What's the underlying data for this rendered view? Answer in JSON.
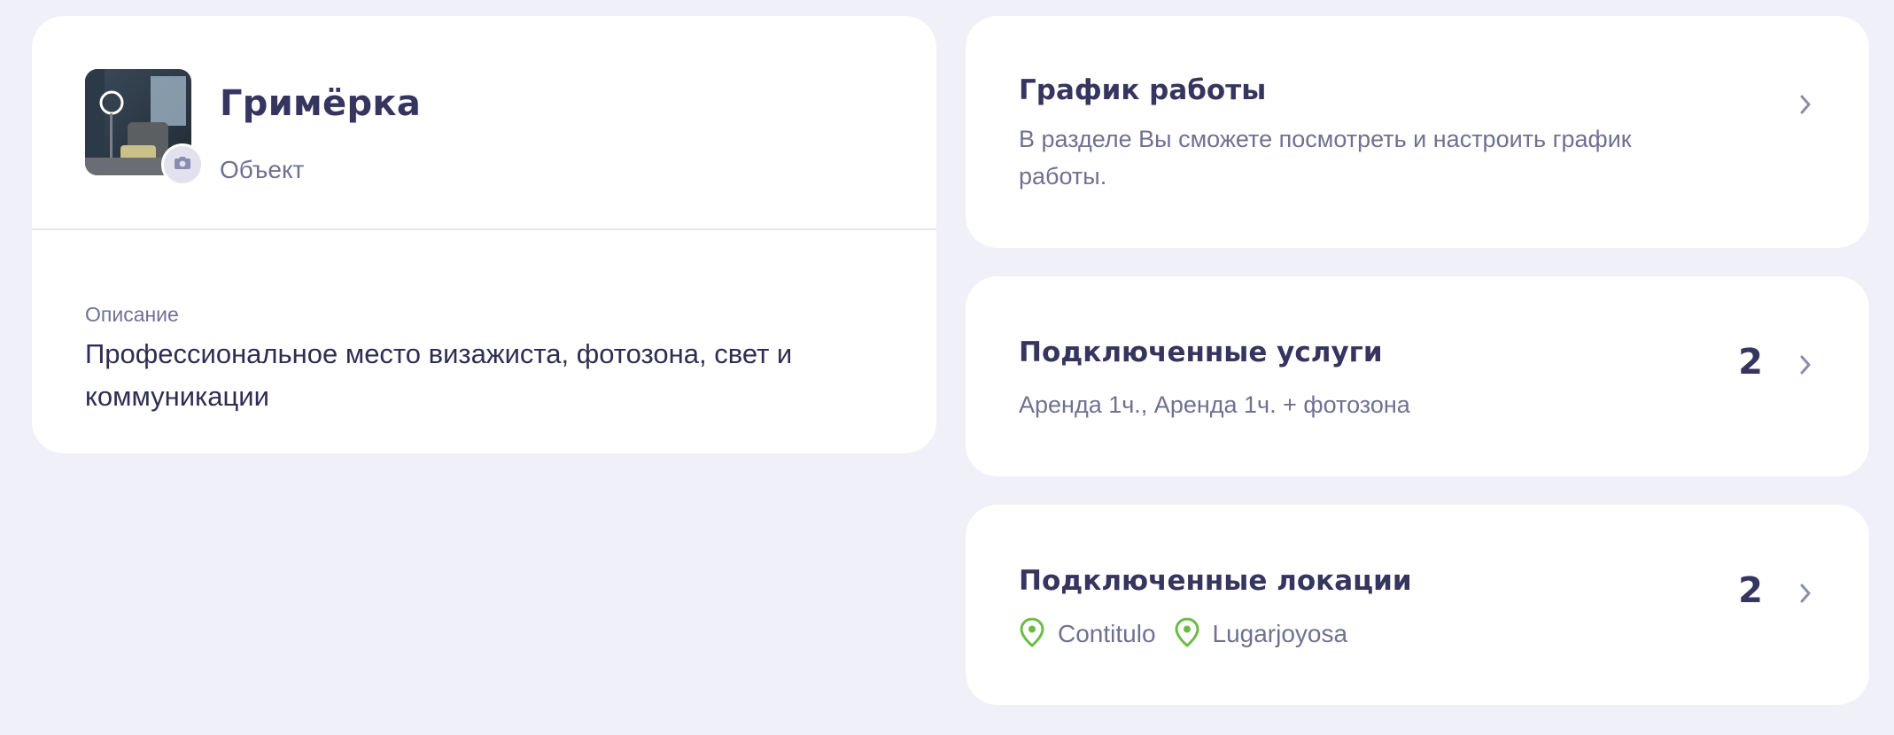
{
  "object": {
    "title": "Гримёрка",
    "type": "Объект",
    "description_label": "Описание",
    "description": "Профессиональное место визажиста, фотозона, свет и коммуникации"
  },
  "schedule": {
    "title": "График работы",
    "subtitle": "В разделе Вы сможете посмотреть и настроить график работы."
  },
  "services": {
    "title": "Подключенные услуги",
    "count": "2",
    "subtitle": "Аренда 1ч., Аренда 1ч. + фотозона"
  },
  "locations": {
    "title": "Подключенные локации",
    "count": "2",
    "items": [
      "Contitulo",
      "Lugarjoyosa"
    ]
  },
  "colors": {
    "background": "#f0f0f9",
    "title": "#35355f",
    "muted": "#6f7190",
    "location_pin": "#6dbb45"
  },
  "icons": {
    "camera": "camera-icon",
    "chevron": "chevron-right-icon",
    "location": "location-pin-icon"
  }
}
